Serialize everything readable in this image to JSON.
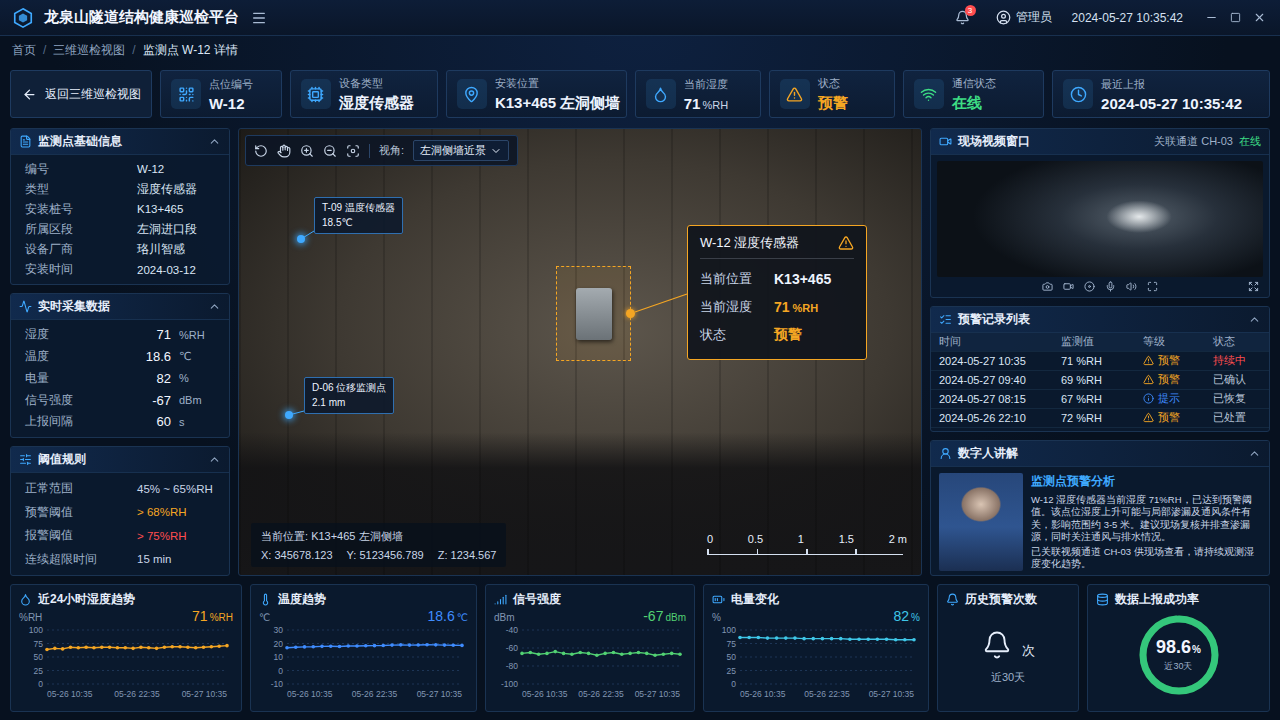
{
  "header": {
    "title": "龙泉山隧道结构健康巡检平台",
    "notification_count": "3",
    "user": "管理员",
    "datetime": "2024-05-27 10:35:42"
  },
  "breadcrumb": {
    "items": [
      "首页",
      "三维巡检视图",
      "监测点 W-12 详情"
    ],
    "separator": "/"
  },
  "summary": {
    "back_button": "返回三维巡检视图",
    "cards": [
      {
        "label": "点位编号",
        "value": "W-12",
        "unit": "",
        "color": "#eef4ff",
        "icon_color": "#3fa9ff"
      },
      {
        "label": "设备类型",
        "value": "湿度传感器",
        "unit": "",
        "color": "#eef4ff",
        "icon_color": "#3fa9ff"
      },
      {
        "label": "安装位置",
        "value": "K13+465 左洞侧墙",
        "unit": "",
        "color": "#eef4ff",
        "icon_color": "#3fa9ff"
      },
      {
        "label": "当前湿度",
        "value": "71",
        "unit": "%RH",
        "color": "#eef4ff",
        "icon_color": "#3fa9ff"
      },
      {
        "label": "状态",
        "value": "预警",
        "unit": "",
        "color": "#f5a623",
        "icon_color": "#f5a623"
      },
      {
        "label": "通信状态",
        "value": "在线",
        "unit": "",
        "color": "#3ddc84",
        "icon_color": "#3ddc84"
      },
      {
        "label": "最近上报",
        "value": "2024-05-27  10:35:42",
        "unit": "",
        "color": "#eef4ff",
        "icon_color": "#3fa9ff"
      }
    ]
  },
  "basic_info": {
    "title": "监测点基础信息",
    "expanded": true,
    "rows": [
      {
        "label": "编号",
        "value": "W-12"
      },
      {
        "label": "类型",
        "value": "湿度传感器"
      },
      {
        "label": "安装桩号",
        "value": "K13+465"
      },
      {
        "label": "所属区段",
        "value": "左洞进口段"
      },
      {
        "label": "设备厂商",
        "value": "珞川智感"
      },
      {
        "label": "安装时间",
        "value": "2024-03-12"
      }
    ]
  },
  "realtime": {
    "title": "实时采集数据",
    "expanded": true,
    "rows": [
      {
        "label": "湿度",
        "value": "71",
        "unit": "%RH"
      },
      {
        "label": "温度",
        "value": "18.6",
        "unit": "℃"
      },
      {
        "label": "电量",
        "value": "82",
        "unit": "%"
      },
      {
        "label": "信号强度",
        "value": "-67",
        "unit": "dBm"
      },
      {
        "label": "上报间隔",
        "value": "60",
        "unit": "s"
      }
    ]
  },
  "thresholds": {
    "title": "阈值规则",
    "expanded": true,
    "rows": [
      {
        "label": "正常范围",
        "value": "45% ~ 65%RH",
        "color": "#c9d6e8"
      },
      {
        "label": "预警阈值",
        "value": "> 68%RH",
        "color": "#f5a623"
      },
      {
        "label": "报警阈值",
        "value": "> 75%RH",
        "color": "#ff4d4f"
      },
      {
        "label": "连续超限时间",
        "value": "15 min",
        "color": "#c9d6e8"
      }
    ]
  },
  "scene": {
    "view_label": "视角:",
    "view_value": "左洞侧墙近景",
    "markers": [
      {
        "code": "T-09",
        "name": "温度传感器",
        "value": "18.5℃"
      },
      {
        "code": "D-06",
        "name": "位移监测点",
        "value": "2.1 mm"
      }
    ],
    "popup": {
      "title": "W-12 湿度传感器",
      "rows": [
        {
          "label": "当前位置",
          "value": "K13+465",
          "unit": "",
          "color": "#eef4ff"
        },
        {
          "label": "当前湿度",
          "value": "71",
          "unit": "%RH",
          "color": "#f5a623"
        },
        {
          "label": "状态",
          "value": "预警",
          "unit": "",
          "color": "#f5a623"
        }
      ]
    },
    "position": {
      "label": "当前位置:",
      "value": "K13+465 左洞侧墙"
    },
    "coords": [
      {
        "axis": "X:",
        "value": "345678.123"
      },
      {
        "axis": "Y:",
        "value": "5123456.789"
      },
      {
        "axis": "Z:",
        "value": "1234.567"
      }
    ],
    "scale_ticks": [
      "0",
      "0.5",
      "1",
      "1.5",
      "2 m"
    ]
  },
  "video": {
    "title": "现场视频窗口",
    "channel_label": "关联通道",
    "channel": "CH-03",
    "status": "在线"
  },
  "alerts": {
    "title": "预警记录列表",
    "expanded": true,
    "columns": [
      "时间",
      "监测值",
      "等级",
      "状态"
    ],
    "rows": [
      {
        "time": "2024-05-27 10:35",
        "value": "71 %RH",
        "level": "预警",
        "kind": "warning",
        "status": "持续中",
        "color": "#ff4d4f"
      },
      {
        "time": "2024-05-27 09:40",
        "value": "69 %RH",
        "level": "预警",
        "kind": "warning",
        "status": "已确认",
        "color": "#b7c4d6"
      },
      {
        "time": "2024-05-27 08:15",
        "value": "67 %RH",
        "level": "提示",
        "kind": "info",
        "status": "已恢复",
        "color": "#b7c4d6"
      },
      {
        "time": "2024-05-26 22:10",
        "value": "72 %RH",
        "level": "预警",
        "kind": "warning",
        "status": "已处置",
        "color": "#b7c4d6"
      }
    ]
  },
  "digital_human": {
    "title": "数字人讲解",
    "expanded": true,
    "heading": "监测点预警分析",
    "paragraphs": [
      "W-12 湿度传感器当前湿度 71%RH，已达到预警阈值。该点位湿度上升可能与局部渗漏及通风条件有关，影响范围约 3-5 米。建议现场复核并排查渗漏源，同时关注通风与排水情况。",
      "已关联视频通道 CH-03 供现场查看，请持续观测湿度变化趋势。"
    ]
  },
  "charts": [
    {
      "title": "近24小时湿度趋势",
      "reading": "71",
      "unit": "%RH",
      "axis_unit": "%RH",
      "y_ticks": [
        "100",
        "75",
        "50",
        "25",
        "0"
      ],
      "x_ticks": [
        "05-26 10:35",
        "05-26 22:35",
        "05-27 10:35"
      ],
      "color": "#f5a623",
      "values": [
        64,
        66,
        65,
        68,
        67,
        68,
        67,
        68,
        68,
        67,
        67,
        66,
        68,
        67,
        66,
        68,
        69,
        69,
        68,
        67,
        68,
        69,
        70,
        71
      ]
    },
    {
      "title": "温度趋势",
      "reading": "18.6",
      "unit": "℃",
      "axis_unit": "℃",
      "y_ticks": [
        "30",
        "20",
        "10",
        "0",
        "-10"
      ],
      "x_ticks": [
        "05-26 10:35",
        "05-26 22:35",
        "05-27 10:35"
      ],
      "color": "#3f8cff",
      "values": [
        16.8,
        17.2,
        17.5,
        17.6,
        17.9,
        18.0,
        17.8,
        18.1,
        18.2,
        18.3,
        18.4,
        18.5,
        18.8,
        19.0,
        18.8,
        18.9,
        19.1,
        19.0,
        18.8,
        18.7,
        18.6
      ]
    },
    {
      "title": "信号强度",
      "reading": "-67",
      "unit": "dBm",
      "axis_unit": "dBm",
      "y_ticks": [
        "-40",
        "-60",
        "-80",
        "-100"
      ],
      "x_ticks": [
        "05-26 10:35",
        "05-26 22:35",
        "05-27 10:35"
      ],
      "color": "#52d273",
      "values": [
        -66,
        -65,
        -67,
        -66,
        -64,
        -66,
        -67,
        -65,
        -66,
        -68,
        -66,
        -65,
        -67,
        -66,
        -65,
        -66,
        -68,
        -67,
        -66,
        -67
      ]
    },
    {
      "title": "电量变化",
      "reading": "82",
      "unit": "%",
      "axis_unit": "%",
      "y_ticks": [
        "100",
        "75",
        "50",
        "25",
        "0"
      ],
      "x_ticks": [
        "05-26 10:35",
        "05-26 22:35",
        "05-27 10:35"
      ],
      "color": "#3fc7e8",
      "values": [
        86,
        86,
        86,
        85,
        85,
        85,
        85,
        84,
        84,
        84,
        84,
        84,
        83,
        83,
        83,
        83,
        83,
        82,
        82,
        82
      ]
    }
  ],
  "history_alerts": {
    "title": "历史预警次数",
    "unit": "次",
    "period": "近30天"
  },
  "success_rate": {
    "title": "数据上报成功率",
    "value": "98.6",
    "unit": "%",
    "period": "近30天",
    "level": 0.986
  }
}
